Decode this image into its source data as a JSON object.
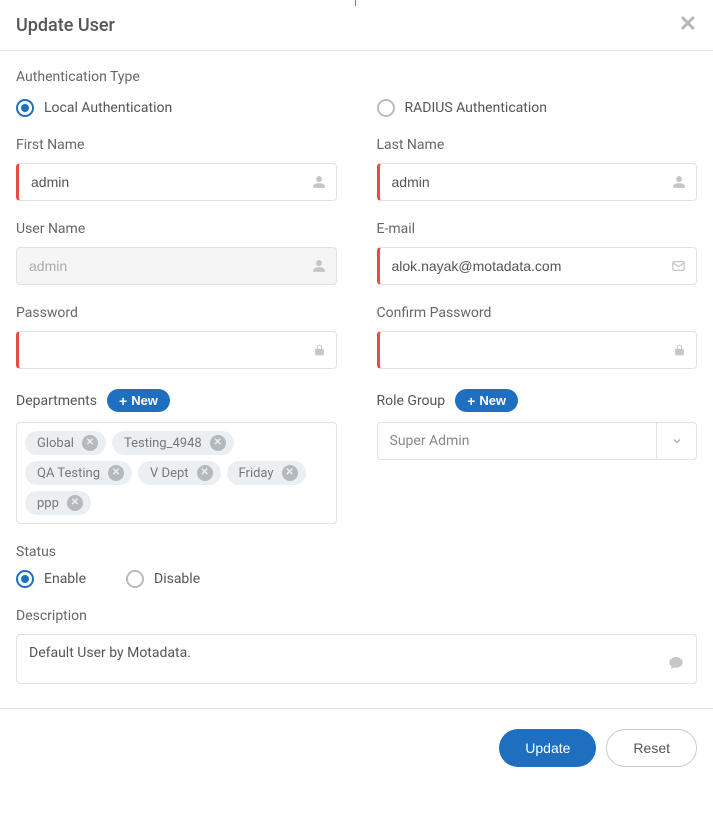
{
  "header": {
    "title": "Update User"
  },
  "auth": {
    "section_label": "Authentication Type",
    "local_label": "Local Authentication",
    "radius_label": "RADIUS Authentication",
    "selected": "local"
  },
  "firstName": {
    "label": "First Name",
    "value": "admin"
  },
  "lastName": {
    "label": "Last Name",
    "value": "admin"
  },
  "userName": {
    "label": "User Name",
    "value": "admin"
  },
  "email": {
    "label": "E-mail",
    "value": "alok.nayak@motadata.com"
  },
  "password": {
    "label": "Password",
    "value": ""
  },
  "confirmPassword": {
    "label": "Confirm Password",
    "value": ""
  },
  "departments": {
    "label": "Departments",
    "new_label": "New",
    "tags": [
      "Global",
      "Testing_4948",
      "QA Testing",
      "V Dept",
      "Friday",
      "ppp"
    ]
  },
  "roleGroup": {
    "label": "Role Group",
    "new_label": "New",
    "value": "Super Admin"
  },
  "status": {
    "label": "Status",
    "enable_label": "Enable",
    "disable_label": "Disable",
    "selected": "enable"
  },
  "description": {
    "label": "Description",
    "value": "Default User by Motadata."
  },
  "footer": {
    "update_label": "Update",
    "reset_label": "Reset"
  }
}
